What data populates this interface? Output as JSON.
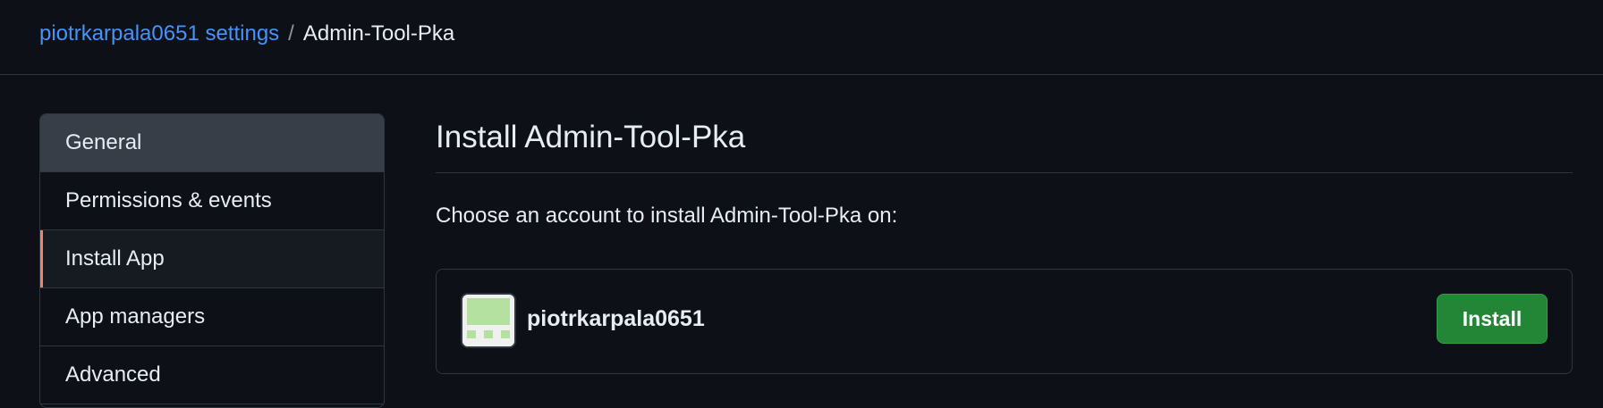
{
  "breadcrumb": {
    "parent": "piotrkarpala0651 settings",
    "separator": "/",
    "current": "Admin-Tool-Pka"
  },
  "sidebar": {
    "items": [
      {
        "label": "General",
        "state": "hover"
      },
      {
        "label": "Permissions & events",
        "state": "default"
      },
      {
        "label": "Install App",
        "state": "selected"
      },
      {
        "label": "App managers",
        "state": "default"
      },
      {
        "label": "Advanced",
        "state": "default"
      }
    ]
  },
  "main": {
    "title": "Install Admin-Tool-Pka",
    "prompt": "Choose an account to install Admin-Tool-Pka on:",
    "account": {
      "name": "piotrkarpala0651",
      "avatar_icon": "identicon-avatar"
    },
    "install_label": "Install"
  },
  "colors": {
    "background": "#0d1117",
    "link": "#4493f8",
    "selected_indicator": "#f78166",
    "install_button": "#238636",
    "avatar_pattern": "#b4e0a0"
  }
}
